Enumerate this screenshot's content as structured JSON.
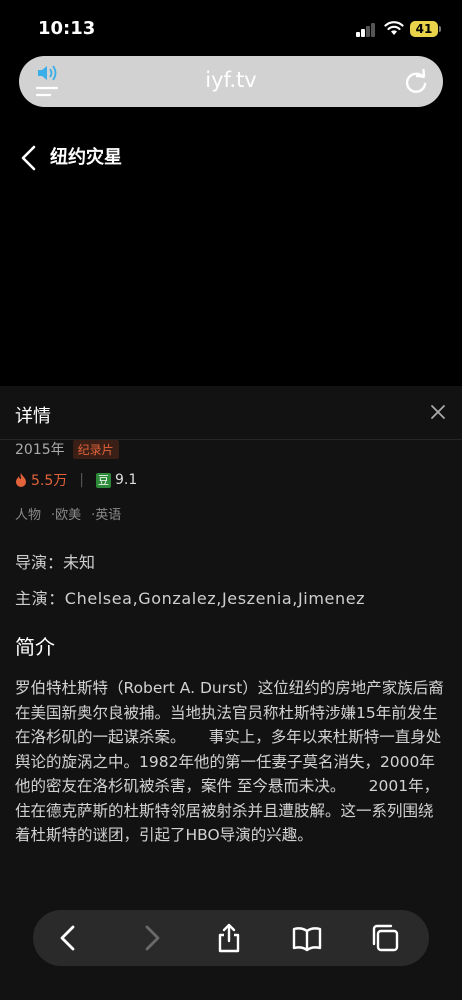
{
  "status": {
    "time": "10:13",
    "battery": "41"
  },
  "browser": {
    "url": "iyf.tv"
  },
  "video": {
    "title": "纽约灾星"
  },
  "details": {
    "heading": "详情",
    "year": "2015年",
    "genre_tag": "纪录片",
    "heat": "5.5万",
    "douban_badge": "豆",
    "score": "9.1",
    "tags": [
      "人物",
      "·欧美",
      "·英语"
    ],
    "director": "导演：未知",
    "cast": "主演：Chelsea,Gonzalez,Jeszenia,Jimenez",
    "intro_title": "简介",
    "intro": "罗伯特杜斯特（Robert A. Durst）这位纽约的房地产家族后裔在美国新奥尔良被捕。当地执法官员称杜斯特涉嫌15年前发生在洛杉矶的一起谋杀案。　　事实上，多年以来杜斯特一直身处舆论的旋涡之中。1982年他的第一任妻子莫名消失，2000年他的密友在洛杉矶被杀害，案件 至今悬而未决。　　2001年，住在德克萨斯的杜斯特邻居被射杀并且遭肢解。这一系列围绕着杜斯特的谜团，引起了HBO导演的兴趣。"
  },
  "colors": {
    "accent": "#e2623a",
    "battery": "#e8d34a",
    "douban": "#2d8a3a"
  }
}
